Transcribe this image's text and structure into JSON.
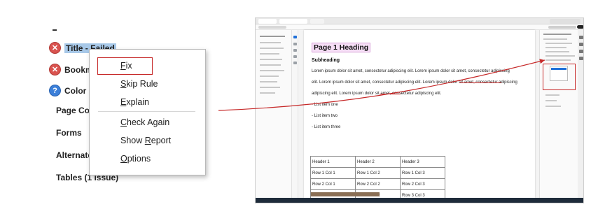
{
  "left_panel": {
    "rows": [
      {
        "text": "Title - Failed",
        "icon": "fail-icon"
      },
      {
        "text": "Bookm",
        "icon": "fail-icon"
      },
      {
        "text": "Color c",
        "icon": "question-icon"
      }
    ],
    "categories": [
      "Page Con",
      "Forms",
      "Alternate",
      "Tables (1 issue)"
    ]
  },
  "context_menu": {
    "items": [
      {
        "pre": "",
        "u": "F",
        "post": "ix"
      },
      {
        "pre": "",
        "u": "S",
        "post": "kip Rule"
      },
      {
        "pre": "",
        "u": "E",
        "post": "xplain"
      },
      {
        "pre": "",
        "u": "C",
        "post": "heck Again"
      },
      {
        "pre": "Show ",
        "u": "R",
        "post": "eport"
      },
      {
        "pre": "",
        "u": "O",
        "post": "ptions"
      }
    ]
  },
  "document": {
    "heading": "Page 1 Heading",
    "subheading": "Subheading",
    "paragraph_lines": [
      "Lorem ipsum dolor sit amet, consectetur adipiscing elit. Lorem ipsum dolor sit amet, consectetur adipiscing",
      "elit. Lorem ipsum dolor sit amet, consectetur adipiscing elit. Lorem ipsum dolor sit amet, consectetur adipiscing",
      "adipiscing elit. Lorem ipsum dolor sit amet, consectetur adipiscing elit."
    ],
    "list_items": [
      "- List item one",
      "- List item two",
      "- List item three"
    ],
    "table": {
      "headers": [
        "Header 1",
        "Header 2",
        "Header 3"
      ],
      "rows": [
        [
          "Row 1 Col 1",
          "Row 1 Col 2",
          "Row 1 Col 3"
        ],
        [
          "Row 2 Col 1",
          "Row 2 Col 2",
          "Row 2 Col 3"
        ],
        [
          "Row 3 Col 1",
          "Row 3 Col 2",
          "Row 3 Col 3"
        ]
      ]
    }
  },
  "colors": {
    "annotation_red": "#c62828",
    "selection": "#a7c8e8",
    "heading_highlight": "#f6dff6"
  }
}
